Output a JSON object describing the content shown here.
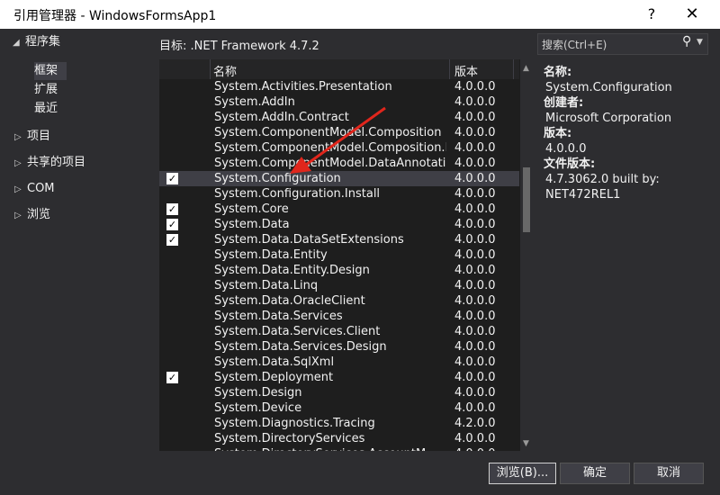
{
  "window": {
    "title": "引用管理器 - WindowsFormsApp1",
    "help_label": "?",
    "close_label": "✕"
  },
  "nav": {
    "assemblies": "程序集",
    "framework": "框架",
    "extensions": "扩展",
    "recent": "最近",
    "projects": "项目",
    "shared_projects": "共享的项目",
    "com": "COM",
    "browse": "浏览"
  },
  "target": "目标: .NET Framework 4.7.2",
  "grid": {
    "header_name": "名称",
    "header_version": "版本",
    "rows": [
      {
        "name": "System.Activities.Presentation",
        "version": "4.0.0.0",
        "checked": false
      },
      {
        "name": "System.AddIn",
        "version": "4.0.0.0",
        "checked": false
      },
      {
        "name": "System.AddIn.Contract",
        "version": "4.0.0.0",
        "checked": false
      },
      {
        "name": "System.ComponentModel.Composition",
        "version": "4.0.0.0",
        "checked": false
      },
      {
        "name": "System.ComponentModel.Composition.Re...",
        "version": "4.0.0.0",
        "checked": false
      },
      {
        "name": "System.ComponentModel.DataAnnotations",
        "version": "4.0.0.0",
        "checked": false
      },
      {
        "name": "System.Configuration",
        "version": "4.0.0.0",
        "checked": true,
        "selected": true
      },
      {
        "name": "System.Configuration.Install",
        "version": "4.0.0.0",
        "checked": false
      },
      {
        "name": "System.Core",
        "version": "4.0.0.0",
        "checked": true
      },
      {
        "name": "System.Data",
        "version": "4.0.0.0",
        "checked": true
      },
      {
        "name": "System.Data.DataSetExtensions",
        "version": "4.0.0.0",
        "checked": true
      },
      {
        "name": "System.Data.Entity",
        "version": "4.0.0.0",
        "checked": false
      },
      {
        "name": "System.Data.Entity.Design",
        "version": "4.0.0.0",
        "checked": false
      },
      {
        "name": "System.Data.Linq",
        "version": "4.0.0.0",
        "checked": false
      },
      {
        "name": "System.Data.OracleClient",
        "version": "4.0.0.0",
        "checked": false
      },
      {
        "name": "System.Data.Services",
        "version": "4.0.0.0",
        "checked": false
      },
      {
        "name": "System.Data.Services.Client",
        "version": "4.0.0.0",
        "checked": false
      },
      {
        "name": "System.Data.Services.Design",
        "version": "4.0.0.0",
        "checked": false
      },
      {
        "name": "System.Data.SqlXml",
        "version": "4.0.0.0",
        "checked": false
      },
      {
        "name": "System.Deployment",
        "version": "4.0.0.0",
        "checked": true
      },
      {
        "name": "System.Design",
        "version": "4.0.0.0",
        "checked": false
      },
      {
        "name": "System.Device",
        "version": "4.0.0.0",
        "checked": false
      },
      {
        "name": "System.Diagnostics.Tracing",
        "version": "4.2.0.0",
        "checked": false
      },
      {
        "name": "System.DirectoryServices",
        "version": "4.0.0.0",
        "checked": false
      },
      {
        "name": "System.DirectoryServices.AccountM...",
        "version": "4.0.0.0",
        "checked": false
      }
    ]
  },
  "search": {
    "placeholder": "搜索(Ctrl+E)"
  },
  "details": {
    "name_label": "名称:",
    "name_value": "System.Configuration",
    "creator_label": "创建者:",
    "creator_value": "Microsoft Corporation",
    "version_label": "版本:",
    "version_value": "4.0.0.0",
    "file_version_label": "文件版本:",
    "file_version_value_1": "4.7.3062.0 built by:",
    "file_version_value_2": "NET472REL1"
  },
  "buttons": {
    "browse": "浏览(B)...",
    "ok": "确定",
    "cancel": "取消"
  },
  "colors": {
    "background": "#2d2d30",
    "list_bg": "#1e1e1e",
    "selected_row": "#3f3f46",
    "arrow": "#e0261c"
  },
  "icons": {
    "search": "magnifier-icon",
    "expand": "triangle-right-icon",
    "collapse": "triangle-down-icon"
  }
}
